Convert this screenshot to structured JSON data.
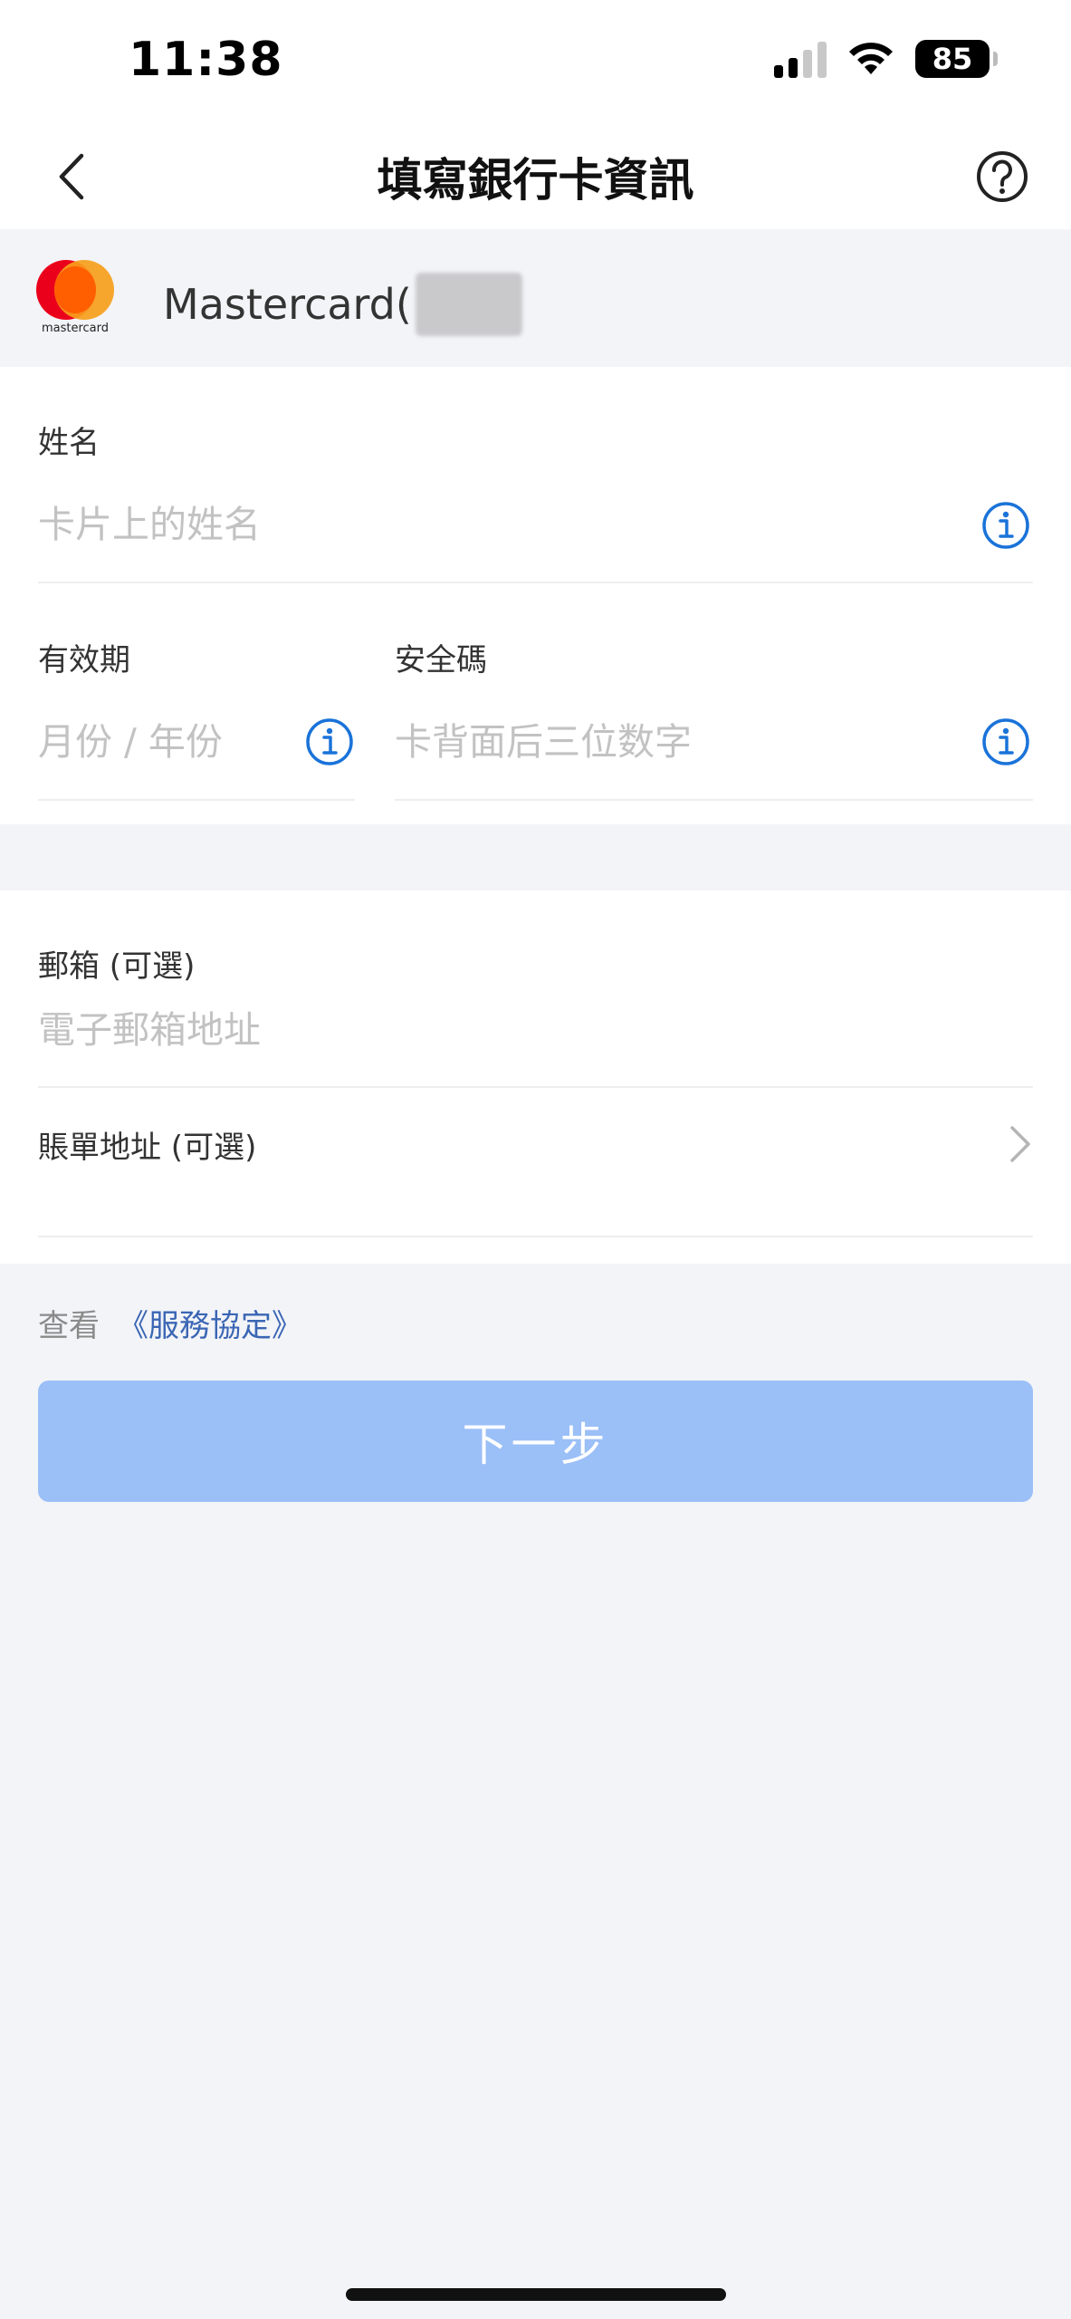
{
  "status_bar": {
    "time": "11:38",
    "battery": "85"
  },
  "nav": {
    "title": "填寫銀行卡資訊"
  },
  "card": {
    "brand_label": "Mastercard(",
    "logo_text": "mastercard",
    "logo_colors": {
      "red": "#eb001b",
      "orange": "#f79e1b",
      "overlap": "#ff5f00"
    }
  },
  "form": {
    "name": {
      "label": "姓名",
      "placeholder": "卡片上的姓名"
    },
    "expiry": {
      "label": "有效期",
      "placeholder": "月份 / 年份"
    },
    "cvv": {
      "label": "安全碼",
      "placeholder": "卡背面后三位数字"
    },
    "email": {
      "label": "郵箱 (可選)",
      "placeholder": "電子郵箱地址"
    },
    "billing": {
      "label": "賬單地址 (可選)"
    }
  },
  "footer": {
    "prefix": "查看",
    "link": "《服務協定》"
  },
  "next_button": {
    "label": "下一步",
    "color": "#9bbff7"
  },
  "colors": {
    "accent": "#1a73d9",
    "link": "#3a66b4",
    "background": "#f3f4f8"
  }
}
